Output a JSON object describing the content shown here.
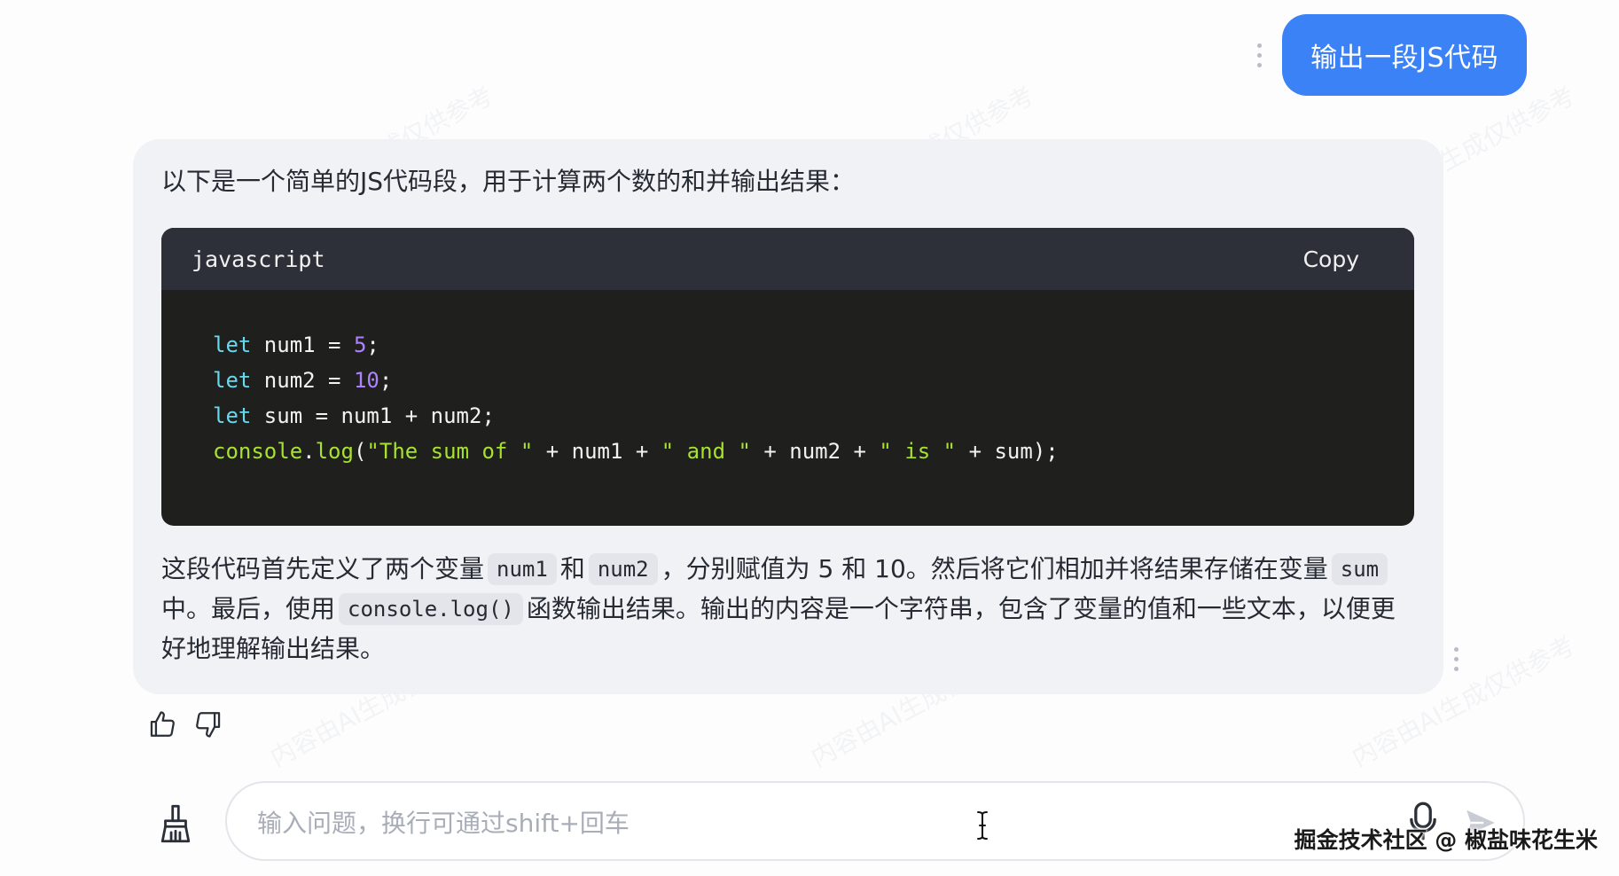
{
  "user_message": {
    "text": "输出一段JS代码"
  },
  "assistant_message": {
    "intro": "以下是一个简单的JS代码段，用于计算两个数的和并输出结果：",
    "code_block": {
      "language": "javascript",
      "copy_label": "Copy",
      "lines": [
        [
          {
            "t": "let",
            "c": "kw"
          },
          {
            "t": " num1 = ",
            "c": "pl"
          },
          {
            "t": "5",
            "c": "num"
          },
          {
            "t": ";",
            "c": "pl"
          }
        ],
        [
          {
            "t": "let",
            "c": "kw"
          },
          {
            "t": " num2 = ",
            "c": "pl"
          },
          {
            "t": "10",
            "c": "num"
          },
          {
            "t": ";",
            "c": "pl"
          }
        ],
        [
          {
            "t": "let",
            "c": "kw"
          },
          {
            "t": " sum = num1 + num2;",
            "c": "pl"
          }
        ],
        [
          {
            "t": "console",
            "c": "fn"
          },
          {
            "t": ".",
            "c": "pl"
          },
          {
            "t": "log",
            "c": "fn"
          },
          {
            "t": "(",
            "c": "pl"
          },
          {
            "t": "\"The sum of \"",
            "c": "str"
          },
          {
            "t": " + num1 + ",
            "c": "pl"
          },
          {
            "t": "\" and \"",
            "c": "str"
          },
          {
            "t": " + num2 + ",
            "c": "pl"
          },
          {
            "t": "\" is \"",
            "c": "str"
          },
          {
            "t": " + sum);",
            "c": "pl"
          }
        ]
      ]
    },
    "explanation": {
      "p1": "这段代码首先定义了两个变量",
      "code1": "num1",
      "p2": "和",
      "code2": "num2",
      "p3": "，分别赋值为 5 和 10。然后将它们相加并将结果存储在变量",
      "code3": "sum",
      "p4": "中。最后，使用",
      "code4": "console.log()",
      "p5": "函数输出结果。输出的内容是一个字符串，包含了变量的值和一些文本，以便更好地理解输出结果。"
    }
  },
  "reactions": {
    "like_icon": "thumbs-up-icon",
    "dislike_icon": "thumbs-down-icon"
  },
  "input_bar": {
    "placeholder": "输入问题，换行可通过shift+回车",
    "value": ""
  },
  "watermark_text": "内容由AI生成仅供参考",
  "source_credit": "掘金技术社区 @ 椒盐味花生米",
  "colors": {
    "user_bubble": "#3b82f6",
    "assistant_bg": "#f1f2f5",
    "code_bg": "#1f1f1d",
    "code_header_bg": "#2e3039"
  }
}
